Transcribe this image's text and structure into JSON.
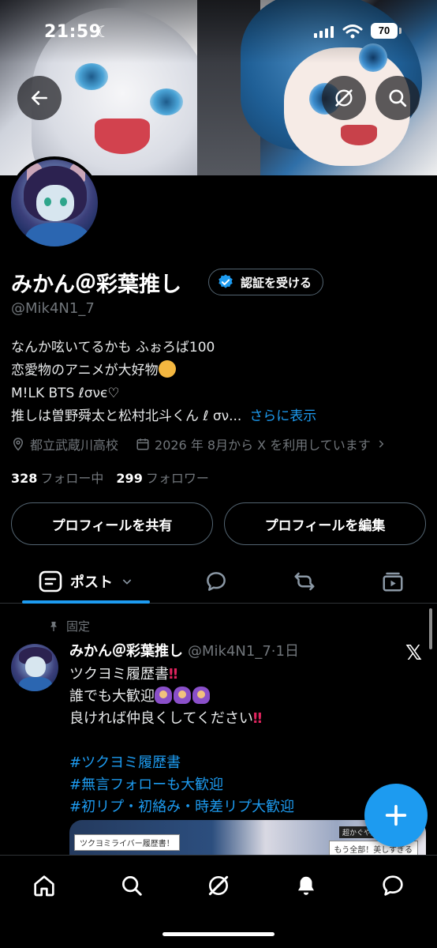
{
  "status_bar": {
    "time": "21:59",
    "moon_icon": "moon-icon",
    "battery": "70"
  },
  "header": {
    "back_icon": "arrow-left-icon",
    "grok_icon": "grok-icon",
    "search_icon": "search-icon"
  },
  "profile": {
    "name": "みかん＠彩葉推し",
    "verify_label": "認証を受ける",
    "handle": "@Mik4N1_7",
    "bio": [
      "なんか呟いてるかも ふぉろば100",
      "恋愛物のアニメが大好物",
      "M!LK BTS ℓσνє♡",
      "推しは曽野舜太と松村北斗くん ℓ σν..."
    ],
    "bio_more": "さらに表示",
    "location": "都立武蔵川高校",
    "joined": "2026 年 8月から X を利用しています",
    "following_count": "328",
    "following_label": "フォロー中",
    "followers_count": "299",
    "followers_label": "フォロワー",
    "share_button": "プロフィールを共有",
    "edit_button": "プロフィールを編集"
  },
  "tabs": {
    "posts_label": "ポスト",
    "items": [
      "posts-tab",
      "replies-tab",
      "reposts-tab",
      "media-tab"
    ]
  },
  "post": {
    "pinned_label": "固定",
    "author_name": "みかん＠彩葉推し",
    "author_meta": "@Mik4N1_7·1日",
    "line1": "ツクヨミ履歴書",
    "line2": "誰でも大歓迎",
    "line3": "良ければ仲良くしてください",
    "tag1": "#ツクヨミ履歴書",
    "tag2": "#無言フォローも大歓迎",
    "tag3": "#初リプ・初絡み・時差リプ大歓迎",
    "media_label_left": "ツクヨミライバー履歴書！",
    "media_label_right": "もう全部！美しすぎる",
    "media_label_top": "超かぐや姫！の好"
  },
  "bottom_nav": [
    "home-icon",
    "search-icon",
    "grok-icon",
    "bell-icon",
    "messages-icon"
  ],
  "colors": {
    "accent": "#1d9bf0",
    "muted": "#71767b",
    "border": "#536471",
    "background": "#000000"
  }
}
